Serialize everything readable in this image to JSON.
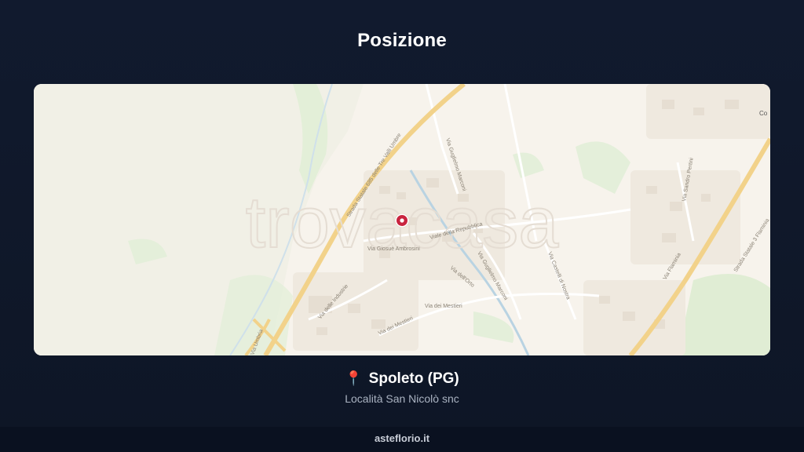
{
  "header": {
    "title": "Posizione"
  },
  "map": {
    "watermark": "trovacasa",
    "labels": {
      "road_ss685": "Strada Statale 685 delle Tre Valli Umbre",
      "road_ss3": "Strada Statale 3 Flaminia",
      "via_marconi": "Via Guglielmo Marconi",
      "via_marconi_2": "Via Guglielmo Marconi",
      "via_mestieri": "Via dei Mestieri",
      "via_mestieri_2": "Via dei Mestieri",
      "via_ambrosini": "Via Giosuè Ambrosini",
      "via_repubblica": "Viale della Repubblica",
      "via_cerquiglia": "Via delle Industrie",
      "via_nostra": "Via Castelli di Nostra",
      "via_pertini": "Via Sandro Pertini",
      "via_flaminia": "Via Flaminia",
      "via_umbria": "Via Umbria",
      "via_dell_orto": "Via dell'Orto",
      "corner_label": "Co"
    }
  },
  "location": {
    "city": "Spoleto (PG)",
    "address": "Località San Nicolò snc",
    "pin_color": "#e63b5a"
  },
  "footer": {
    "site": "asteflorio.it"
  }
}
